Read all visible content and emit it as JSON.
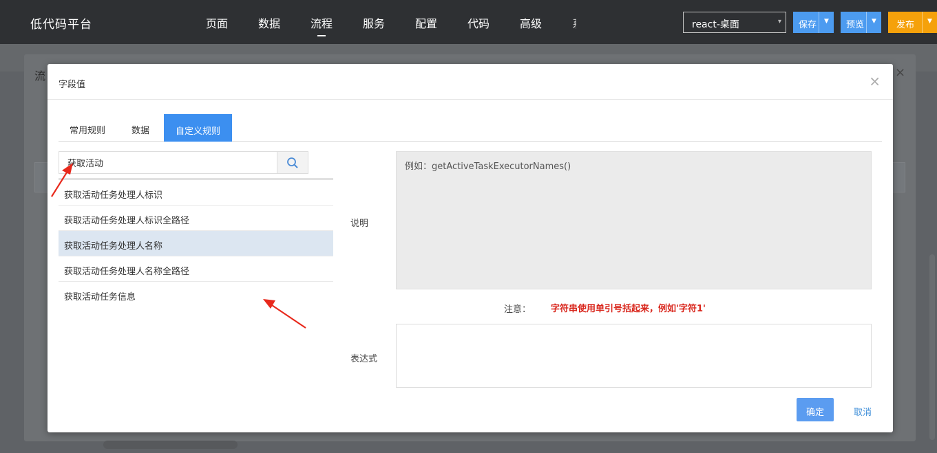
{
  "app": {
    "title": "低代码平台",
    "nav": [
      {
        "label": "页面"
      },
      {
        "label": "数据"
      },
      {
        "label": "流程",
        "active": true
      },
      {
        "label": "服务"
      },
      {
        "label": "配置"
      },
      {
        "label": "代码"
      },
      {
        "label": "高级"
      }
    ],
    "app_select_value": "react-桌面",
    "save_label": "保存",
    "preview_label": "预览",
    "publish_label": "发布"
  },
  "background": {
    "panel_title": "流",
    "panel_close": "×"
  },
  "dialog": {
    "title": "字段值",
    "close": "×",
    "tabs": [
      {
        "label": "常用规则"
      },
      {
        "label": "数据"
      },
      {
        "label": "自定义规则",
        "active": true
      }
    ],
    "search": {
      "value": "获取活动",
      "placeholder": ""
    },
    "list": [
      {
        "label": "获取活动任务处理人标识"
      },
      {
        "label": "获取活动任务处理人标识全路径"
      },
      {
        "label": "获取活动任务处理人名称",
        "selected": true
      },
      {
        "label": "获取活动任务处理人名称全路径"
      },
      {
        "label": "获取活动任务信息"
      }
    ],
    "description_label": "说明",
    "description_text": "例如：getActiveTaskExecutorNames()",
    "note_label": "注意：",
    "note_text": "字符串使用单引号括起来，例如'字符1'",
    "expression_label": "表达式",
    "expression_value": "",
    "ok_label": "确定",
    "cancel_label": "取消"
  },
  "colors": {
    "accent": "#3c8ff0",
    "publish": "#f5a10b",
    "warning_text": "#d9261c",
    "selected_row": "#dce6f1",
    "annotation_arrow": "#e8291c"
  },
  "icons": [
    "search-icon",
    "close-icon",
    "chevron-down-icon"
  ]
}
